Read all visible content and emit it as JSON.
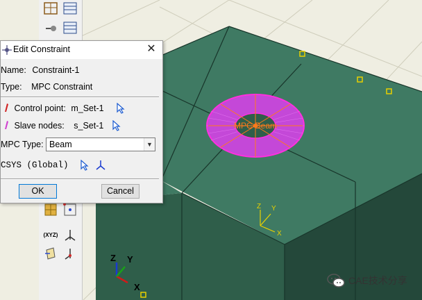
{
  "dialog": {
    "title": "Edit Constraint",
    "name_label": "Name:",
    "name_value": "Constraint-1",
    "type_label": "Type:",
    "type_value": "MPC Constraint",
    "control_point_label": "Control point:",
    "control_point_value": "m_Set-1",
    "slave_nodes_label": "Slave nodes:",
    "slave_nodes_value": "s_Set-1",
    "mpc_type_label": "MPC Type:",
    "mpc_type_value": "Beam",
    "csys_label": "CSYS (Global)",
    "ok_label": "OK",
    "cancel_label": "Cancel"
  },
  "viewport": {
    "mpc_label": "MPC-Beam",
    "local_axis_x": "X",
    "local_axis_y": "Y",
    "local_axis_z": "Z",
    "triad_x": "X",
    "triad_y": "Y",
    "triad_z": "Z"
  },
  "toolbox": {
    "xyz_label": "(XYZ)"
  },
  "watermark": {
    "text": "CAE技术分享"
  },
  "colors": {
    "model_top": "#3f7a63",
    "model_side": "#2f5e4a",
    "model_dark": "#24483a",
    "ground": "#efeee2",
    "mpc_magenta": "#d04ae0",
    "mpc_orange": "#ff7a1a",
    "highlight_yellow": "#e8d000"
  }
}
